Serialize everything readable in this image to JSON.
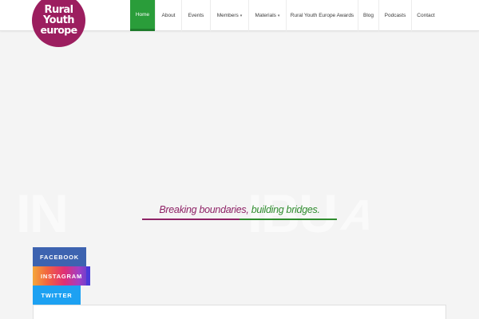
{
  "logo": {
    "lines": [
      "Rural",
      "Youth",
      "europe"
    ]
  },
  "nav": {
    "items": [
      {
        "label": "Home",
        "active": true
      },
      {
        "label": "About"
      },
      {
        "label": "Events"
      },
      {
        "label": "Members",
        "caret": "▾"
      },
      {
        "label": "Materials",
        "caret": "▾"
      },
      {
        "label": "Rural Youth Europe Awards"
      },
      {
        "label": "Blog"
      },
      {
        "label": "Podcasts"
      },
      {
        "label": "Contact"
      }
    ]
  },
  "hero": {
    "tagline_part1": "Breaking boundaries,",
    "tagline_part2": "building bridges."
  },
  "social": {
    "facebook": "FACEBOOK",
    "instagram": "INSTAGRAM",
    "twitter": "TWITTER"
  },
  "colors": {
    "brand_purple": "#9c1e5f",
    "nav_active_green": "#2a9d3a",
    "facebook_blue": "#3d63b0",
    "twitter_blue": "#1da1f2"
  }
}
